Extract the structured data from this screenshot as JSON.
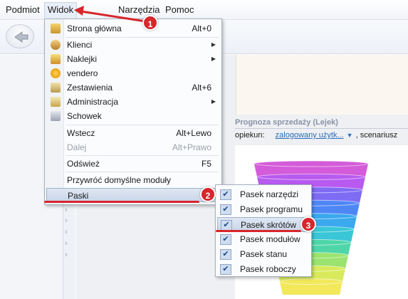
{
  "menubar": {
    "items": [
      {
        "label": "Podmiot"
      },
      {
        "label": "Widok"
      },
      {
        "label": "Narzędzia"
      },
      {
        "label": "Pomoc"
      }
    ]
  },
  "view_menu": {
    "items": [
      {
        "label": "Strona główna",
        "shortcut": "Alt+0",
        "icon": "home-icon"
      },
      {
        "label": "Klienci",
        "shortcut": "",
        "icon": "clients-icon",
        "submenu": true
      },
      {
        "label": "Naklejki",
        "shortcut": "",
        "icon": "stickers-icon",
        "submenu": true
      },
      {
        "label": "vendero",
        "shortcut": "",
        "icon": "vendero-icon"
      },
      {
        "label": "Zestawienia",
        "shortcut": "Alt+6",
        "icon": "reports-icon"
      },
      {
        "label": "Administracja",
        "shortcut": "",
        "icon": "admin-icon",
        "submenu": true
      },
      {
        "label": "Schowek",
        "shortcut": "",
        "icon": "clipboard-icon"
      },
      {
        "label": "Wstecz",
        "shortcut": "Alt+Lewo"
      },
      {
        "label": "Dalej",
        "shortcut": "Alt+Prawo",
        "disabled": true
      },
      {
        "label": "Odśwież",
        "shortcut": "F5"
      },
      {
        "label": "Przywróć domyślne moduły",
        "shortcut": ""
      },
      {
        "label": "Paski",
        "shortcut": "",
        "submenu": true,
        "active": true
      }
    ]
  },
  "paski_submenu": {
    "items": [
      {
        "label": "Pasek narzędzi",
        "checked": true
      },
      {
        "label": "Pasek programu",
        "checked": true
      },
      {
        "label": "Pasek skrótów",
        "checked": true,
        "active": true
      },
      {
        "label": "Pasek modułów",
        "checked": true
      },
      {
        "label": "Pasek stanu",
        "checked": true
      },
      {
        "label": "Pasek roboczy",
        "checked": true
      }
    ]
  },
  "panel": {
    "title": "Prognoza sprzedaży (Lejek)",
    "filter_label": "opiekun:",
    "filter_value": "zalogowany użytk...",
    "filter_tail": ", scenariusz"
  },
  "chart_data": {
    "type": "funnel",
    "stages": 10,
    "colors": [
      "#d45bd9",
      "#b85af0",
      "#7f6cf5",
      "#4f86f5",
      "#3aa9ee",
      "#39c6d6",
      "#4fd6a8",
      "#9be36f",
      "#d8ea5c",
      "#f2e85a"
    ]
  },
  "badges": [
    "1",
    "2",
    "3"
  ],
  "colors": {
    "accent": "#d7262c",
    "highlight": "#c9d5e8",
    "link": "#2a6db8"
  }
}
